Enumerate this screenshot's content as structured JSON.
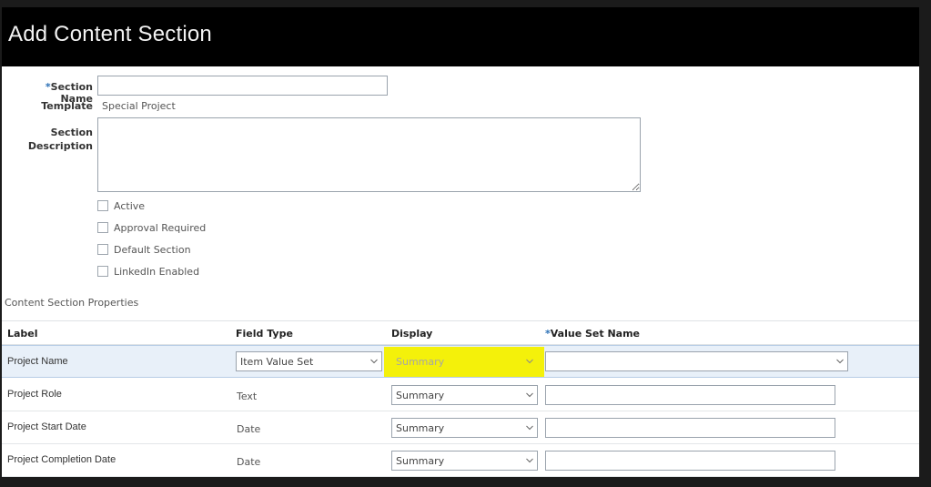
{
  "dialog": {
    "title": "Add Content Section"
  },
  "form": {
    "section_name": {
      "label": "Section Name",
      "required_mark": "*",
      "value": "",
      "placeholder": ""
    },
    "template": {
      "label": "Template",
      "value": "Special Project"
    },
    "section_description": {
      "label_line1": "Section",
      "label_line2": "Description",
      "value": ""
    },
    "checkboxes": [
      {
        "label": "Active",
        "checked": false
      },
      {
        "label": "Approval Required",
        "checked": false
      },
      {
        "label": "Default Section",
        "checked": false
      },
      {
        "label": "LinkedIn Enabled",
        "checked": false
      }
    ]
  },
  "properties": {
    "title": "Content Section Properties",
    "headers": {
      "label": "Label",
      "field_type": "Field Type",
      "display": "Display",
      "value_set_name": "Value Set Name",
      "required_mark": "*"
    },
    "rows": [
      {
        "label": "Project Name",
        "field_type": "Item Value Set",
        "field_type_is_select": true,
        "display": "Summary",
        "value_set_name": "",
        "value_set_is_select": true,
        "selected": true,
        "display_highlighted": true
      },
      {
        "label": "Project Role",
        "field_type": "Text",
        "field_type_is_select": false,
        "display": "Summary",
        "value_set_name": "",
        "value_set_is_select": false,
        "selected": false,
        "display_highlighted": false
      },
      {
        "label": "Project Start Date",
        "field_type": "Date",
        "field_type_is_select": false,
        "display": "Summary",
        "value_set_name": "",
        "value_set_is_select": false,
        "selected": false,
        "display_highlighted": false
      },
      {
        "label": "Project Completion Date",
        "field_type": "Date",
        "field_type_is_select": false,
        "display": "Summary",
        "value_set_name": "",
        "value_set_is_select": false,
        "selected": false,
        "display_highlighted": false
      }
    ]
  },
  "colors": {
    "titlebar_bg": "#000000",
    "highlight": "#f4f10a",
    "selected_row_bg": "#e8f0f9",
    "required_mark": "#2a6fb5"
  },
  "icons": {
    "dropdown": "chevron-down-icon",
    "resize": "resize-grip-icon"
  }
}
